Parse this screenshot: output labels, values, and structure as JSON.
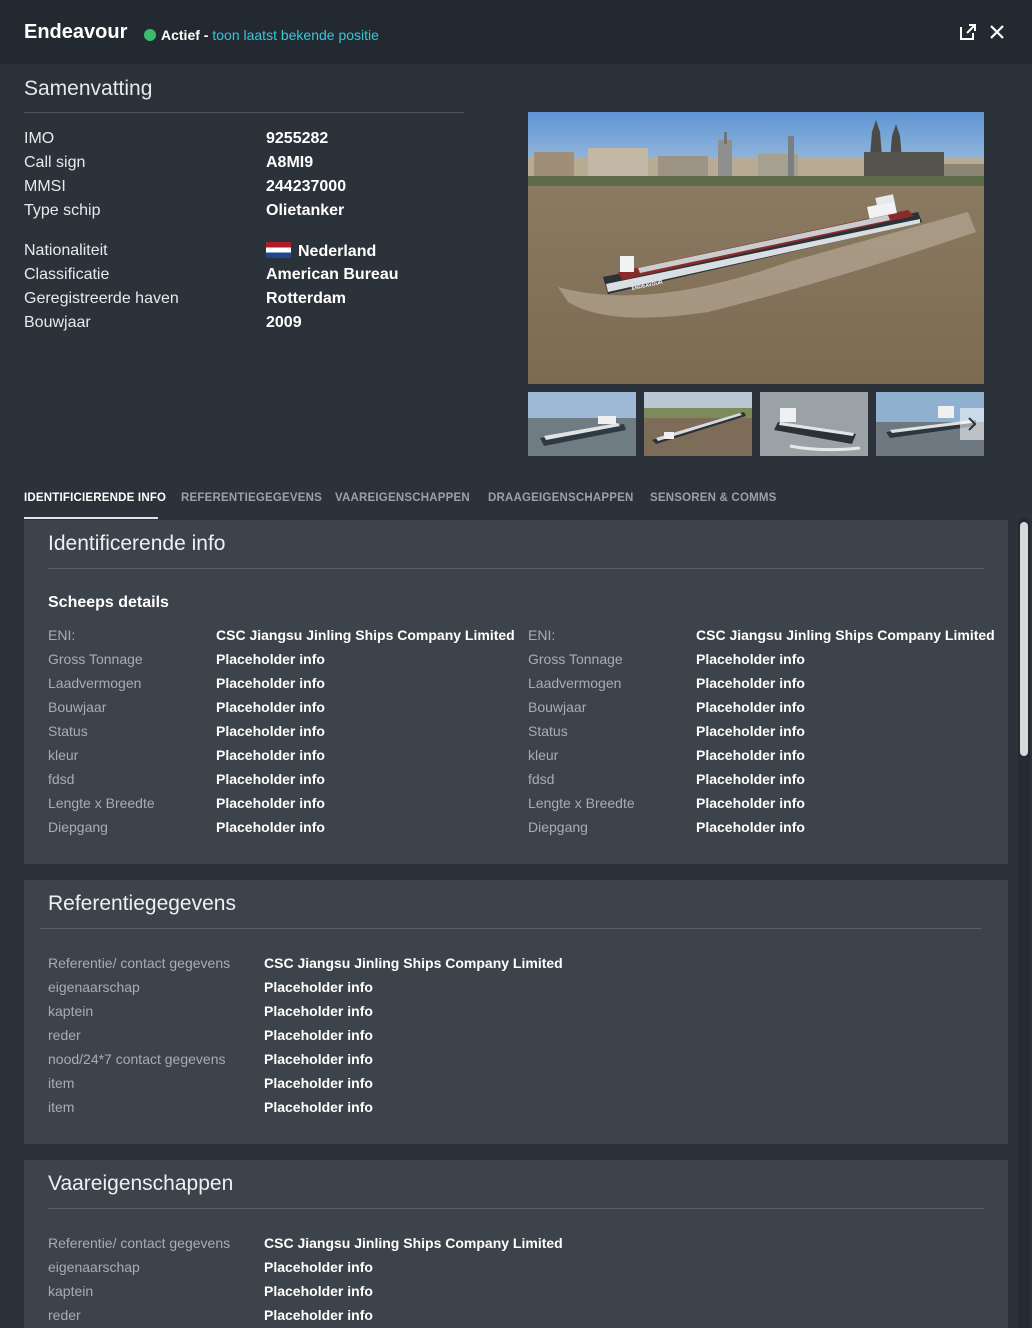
{
  "header": {
    "title": "Endeavour",
    "status": "Actief",
    "separator": " - ",
    "status_link": "toon laatst bekende positie",
    "status_color": "#3dbb6b",
    "link_color": "#38c6d8",
    "icons": [
      "open-external-icon",
      "close-icon"
    ]
  },
  "summary": {
    "title": "Samenvatting",
    "rows": [
      {
        "label": "IMO",
        "value": "9255282"
      },
      {
        "label": "Call sign",
        "value": "A8MI9"
      },
      {
        "label": "MMSI",
        "value": "244237000"
      },
      {
        "label": "Type schip",
        "value": "Olietanker"
      },
      {
        "label": "Nationaliteit",
        "value": "Nederland",
        "flag": "nl-flag-icon"
      },
      {
        "label": "Classificatie",
        "value": "American Bureau"
      },
      {
        "label": "Geregistreerde haven",
        "value": "Rotterdam"
      },
      {
        "label": "Bouwjaar",
        "value": "2009"
      }
    ]
  },
  "gallery": {
    "hull_name": "ENDEAVOUR",
    "next_icon": "chevron-right-icon"
  },
  "tabs": [
    {
      "label": "IDENTIFICIERENDE INFO",
      "active": true
    },
    {
      "label": "REFERENTIEGEGEVENS",
      "active": false
    },
    {
      "label": "VAAREIGENSCHAPPEN",
      "active": false
    },
    {
      "label": "DRAAGEIGENSCHAPPEN",
      "active": false
    },
    {
      "label": "SENSOREN & COMMS",
      "active": false
    }
  ],
  "ident": {
    "title": "Identificerende info",
    "subtitle": "Scheeps details",
    "left": [
      {
        "label": "ENI:",
        "value": "CSC Jiangsu Jinling Ships Company Limited"
      },
      {
        "label": "Gross Tonnage",
        "value": "Placeholder info"
      },
      {
        "label": "Laadvermogen",
        "value": "Placeholder info"
      },
      {
        "label": "Bouwjaar",
        "value": "Placeholder info"
      },
      {
        "label": "Status",
        "value": "Placeholder info"
      },
      {
        "label": "kleur",
        "value": "Placeholder info"
      },
      {
        "label": "fdsd",
        "value": "Placeholder info"
      },
      {
        "label": "Lengte x Breedte",
        "value": "Placeholder info"
      },
      {
        "label": "Diepgang",
        "value": "Placeholder info"
      }
    ],
    "right": [
      {
        "label": "ENI:",
        "value": "CSC Jiangsu Jinling Ships Company Limited"
      },
      {
        "label": "Gross Tonnage",
        "value": "Placeholder info"
      },
      {
        "label": "Laadvermogen",
        "value": "Placeholder info"
      },
      {
        "label": "Bouwjaar",
        "value": "Placeholder info"
      },
      {
        "label": "Status",
        "value": "Placeholder info"
      },
      {
        "label": "kleur",
        "value": "Placeholder info"
      },
      {
        "label": "fdsd",
        "value": "Placeholder info"
      },
      {
        "label": "Lengte x Breedte",
        "value": "Placeholder info"
      },
      {
        "label": "Diepgang",
        "value": "Placeholder info"
      }
    ]
  },
  "ref": {
    "title": "Referentiegegevens",
    "rows": [
      {
        "label": "Referentie/ contact gegevens",
        "value": "CSC Jiangsu Jinling Ships Company Limited"
      },
      {
        "label": "eigenaarschap",
        "value": "Placeholder info"
      },
      {
        "label": "kaptein",
        "value": "Placeholder info"
      },
      {
        "label": "reder",
        "value": "Placeholder info"
      },
      {
        "label": "nood/24*7 contact gegevens",
        "value": "Placeholder info"
      },
      {
        "label": "item",
        "value": "Placeholder info"
      },
      {
        "label": "item",
        "value": "Placeholder info"
      }
    ]
  },
  "vaar": {
    "title": "Vaareigenschappen",
    "rows": [
      {
        "label": "Referentie/ contact gegevens",
        "value": "CSC Jiangsu Jinling Ships Company Limited"
      },
      {
        "label": "eigenaarschap",
        "value": "Placeholder info"
      },
      {
        "label": "kaptein",
        "value": "Placeholder info"
      },
      {
        "label": "reder",
        "value": "Placeholder info"
      }
    ]
  }
}
